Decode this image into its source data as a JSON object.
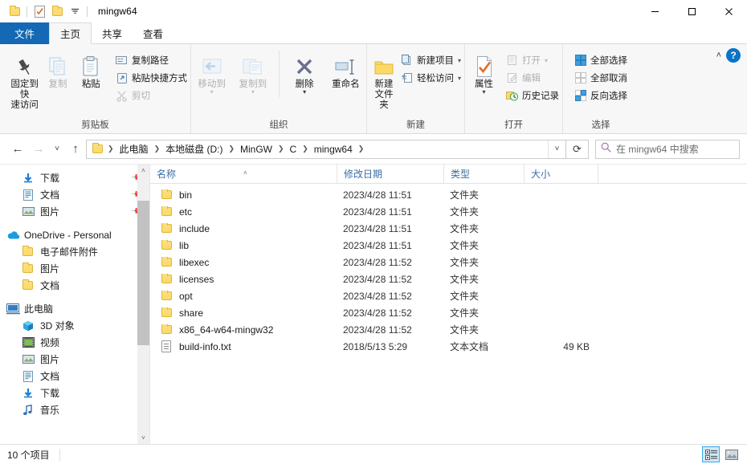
{
  "window": {
    "title": "mingw64",
    "quick_access": [
      "folder-icon",
      "properties-check-icon",
      "new-folder-icon",
      "customize-dropdown-icon"
    ],
    "controls": {
      "minimize": "—",
      "maximize": "☐",
      "close": "✕"
    }
  },
  "tabs": [
    {
      "label": "文件",
      "name": "tab-file",
      "style": "file"
    },
    {
      "label": "主页",
      "name": "tab-home",
      "style": "active"
    },
    {
      "label": "共享",
      "name": "tab-share",
      "style": "normal"
    },
    {
      "label": "查看",
      "name": "tab-view",
      "style": "normal"
    }
  ],
  "ribbon": {
    "collapse_icon": "˄",
    "help_label": "?",
    "groups": [
      {
        "label": "剪贴板",
        "big": [
          {
            "label": "固定到快\n速访问",
            "line1": "固定到快",
            "line2": "速访问",
            "icon": "pin-icon",
            "dim": false
          },
          {
            "label": "复制",
            "line1": "复制",
            "line2": "",
            "icon": "copy-icon",
            "dim": true
          },
          {
            "label": "粘贴",
            "line1": "粘贴",
            "line2": "",
            "icon": "paste-icon",
            "dim": false
          }
        ],
        "small": [
          {
            "label": "复制路径",
            "icon": "copy-path-icon",
            "dim": false
          },
          {
            "label": "粘贴快捷方式",
            "icon": "paste-shortcut-icon",
            "dim": false
          },
          {
            "label": "剪切",
            "icon": "scissors-icon",
            "dim": true
          }
        ]
      },
      {
        "label": "组织",
        "big": [
          {
            "line1": "移动到",
            "line2": "",
            "icon": "move-to-icon",
            "dim": true
          },
          {
            "line1": "复制到",
            "line2": "",
            "icon": "copy-to-icon",
            "dim": true
          },
          {
            "line1": "删除",
            "line2": "",
            "icon": "delete-x-icon",
            "dim": false
          },
          {
            "line1": "重命名",
            "line2": "",
            "icon": "rename-icon",
            "dim": false
          }
        ],
        "small": []
      },
      {
        "label": "新建",
        "big": [
          {
            "line1": "新建",
            "line2": "文件夹",
            "icon": "new-folder-icon",
            "dim": false
          }
        ],
        "small": [
          {
            "label": "新建项目",
            "icon": "new-item-icon",
            "dim": false,
            "caret": true
          },
          {
            "label": "轻松访问",
            "icon": "easy-access-icon",
            "dim": false,
            "caret": true
          }
        ]
      },
      {
        "label": "打开",
        "big": [
          {
            "line1": "属性",
            "line2": "",
            "icon": "properties-icon",
            "dim": false
          }
        ],
        "small": [
          {
            "label": "打开",
            "icon": "open-icon",
            "dim": true,
            "caret": true
          },
          {
            "label": "编辑",
            "icon": "edit-icon",
            "dim": true
          },
          {
            "label": "历史记录",
            "icon": "history-icon",
            "dim": false
          }
        ]
      },
      {
        "label": "选择",
        "big": [],
        "small": [
          {
            "label": "全部选择",
            "icon": "select-all-icon",
            "dim": false
          },
          {
            "label": "全部取消",
            "icon": "select-none-icon",
            "dim": false
          },
          {
            "label": "反向选择",
            "icon": "invert-selection-icon",
            "dim": false
          }
        ]
      }
    ]
  },
  "addressbar": {
    "back_icon": "←",
    "forward_icon": "→",
    "recent_icon": "˅",
    "up_icon": "↑",
    "breadcrumbs": [
      "此电脑",
      "本地磁盘 (D:)",
      "MinGW",
      "C",
      "mingw64"
    ],
    "dropdown_icon": "˅",
    "refresh_icon": "⟳",
    "search_placeholder": "在 mingw64 中搜索",
    "search_value": ""
  },
  "navpane": {
    "items": [
      {
        "label": "下载",
        "icon": "download-icon",
        "indent": 1,
        "pinned": true
      },
      {
        "label": "文档",
        "icon": "documents-icon",
        "indent": 1,
        "pinned": true
      },
      {
        "label": "图片",
        "icon": "pictures-icon",
        "indent": 1,
        "pinned": true
      },
      {
        "label": "",
        "icon": "spacer",
        "indent": 0,
        "spacer": true
      },
      {
        "label": "OneDrive - Personal",
        "icon": "onedrive-icon",
        "indent": 0,
        "pinned": false
      },
      {
        "label": "电子邮件附件",
        "icon": "folder-icon",
        "indent": 1,
        "pinned": false
      },
      {
        "label": "图片",
        "icon": "folder-icon",
        "indent": 1,
        "pinned": false
      },
      {
        "label": "文档",
        "icon": "folder-icon",
        "indent": 1,
        "pinned": false
      },
      {
        "label": "",
        "icon": "spacer",
        "indent": 0,
        "spacer": true
      },
      {
        "label": "此电脑",
        "icon": "this-pc-icon",
        "indent": 0,
        "pinned": false
      },
      {
        "label": "3D 对象",
        "icon": "3d-objects-icon",
        "indent": 1,
        "pinned": false
      },
      {
        "label": "视频",
        "icon": "videos-icon",
        "indent": 1,
        "pinned": false
      },
      {
        "label": "图片",
        "icon": "pictures-icon",
        "indent": 1,
        "pinned": false
      },
      {
        "label": "文档",
        "icon": "documents-icon",
        "indent": 1,
        "pinned": false
      },
      {
        "label": "下载",
        "icon": "download-icon",
        "indent": 1,
        "pinned": false
      },
      {
        "label": "音乐",
        "icon": "music-icon",
        "indent": 1,
        "pinned": false
      }
    ],
    "scroll_up_icon": "˄",
    "scroll_down_icon": "˅"
  },
  "filelist": {
    "columns": [
      {
        "label": "名称",
        "key": "name",
        "sorted": true,
        "sort_icon": "˄"
      },
      {
        "label": "修改日期",
        "key": "date",
        "sorted": false
      },
      {
        "label": "类型",
        "key": "type",
        "sorted": false
      },
      {
        "label": "大小",
        "key": "size",
        "sorted": false
      }
    ],
    "rows": [
      {
        "name": "bin",
        "date": "2023/4/28 11:51",
        "type": "文件夹",
        "size": "",
        "icon": "folder-icon"
      },
      {
        "name": "etc",
        "date": "2023/4/28 11:51",
        "type": "文件夹",
        "size": "",
        "icon": "folder-icon"
      },
      {
        "name": "include",
        "date": "2023/4/28 11:51",
        "type": "文件夹",
        "size": "",
        "icon": "folder-icon"
      },
      {
        "name": "lib",
        "date": "2023/4/28 11:51",
        "type": "文件夹",
        "size": "",
        "icon": "folder-icon"
      },
      {
        "name": "libexec",
        "date": "2023/4/28 11:52",
        "type": "文件夹",
        "size": "",
        "icon": "folder-icon"
      },
      {
        "name": "licenses",
        "date": "2023/4/28 11:52",
        "type": "文件夹",
        "size": "",
        "icon": "folder-icon"
      },
      {
        "name": "opt",
        "date": "2023/4/28 11:52",
        "type": "文件夹",
        "size": "",
        "icon": "folder-icon"
      },
      {
        "name": "share",
        "date": "2023/4/28 11:52",
        "type": "文件夹",
        "size": "",
        "icon": "folder-icon"
      },
      {
        "name": "x86_64-w64-mingw32",
        "date": "2023/4/28 11:52",
        "type": "文件夹",
        "size": "",
        "icon": "folder-icon"
      },
      {
        "name": "build-info.txt",
        "date": "2018/5/13 5:29",
        "type": "文本文档",
        "size": "49 KB",
        "icon": "text-file-icon"
      }
    ]
  },
  "statusbar": {
    "item_count": "10 个项目",
    "views": [
      {
        "name": "details-view-button",
        "selected": true
      },
      {
        "name": "large-icons-view-button",
        "selected": false
      }
    ]
  },
  "colors": {
    "accent": "#1468b4",
    "folder": "#fcd966",
    "link": "#3a6ea5",
    "selection": "#cfeafb"
  }
}
